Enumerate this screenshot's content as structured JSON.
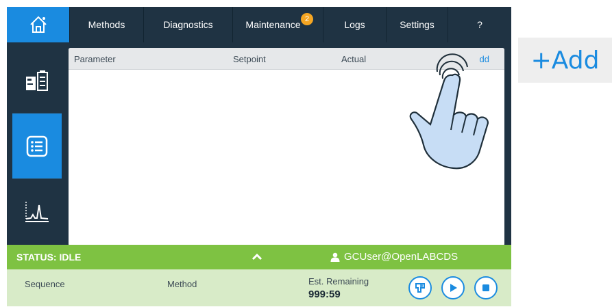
{
  "nav": {
    "home_icon": "home-icon",
    "items": [
      {
        "label": "Methods"
      },
      {
        "label": "Diagnostics"
      },
      {
        "label": "Maintenance",
        "badge": "2"
      },
      {
        "label": "Logs"
      },
      {
        "label": "Settings"
      },
      {
        "label": "?"
      }
    ]
  },
  "rail": {
    "items": [
      {
        "icon": "instrument-icon",
        "active": false
      },
      {
        "icon": "list-icon",
        "active": true
      },
      {
        "icon": "chromatogram-icon",
        "active": false
      }
    ]
  },
  "table": {
    "headers": {
      "parameter": "Parameter",
      "setpoint": "Setpoint",
      "actual": "Actual",
      "add": "dd"
    },
    "rows": []
  },
  "status": {
    "text": "STATUS: IDLE",
    "toggle_icon": "chevron-up-icon",
    "user": "GCUser@OpenLABCDS"
  },
  "info": {
    "sequence_label": "Sequence",
    "method_label": "Method",
    "remaining_label": "Est. Remaining",
    "remaining_value": "999:59"
  },
  "controls": {
    "icons": [
      "prep-run-icon",
      "play-icon",
      "stop-icon"
    ]
  },
  "callout": {
    "label": "+Add"
  },
  "colors": {
    "accent": "#1a8be0",
    "nav_bg": "#1f3343",
    "status_green": "#7ec242",
    "info_bg": "#d8ebc8",
    "badge": "#f5a623"
  }
}
